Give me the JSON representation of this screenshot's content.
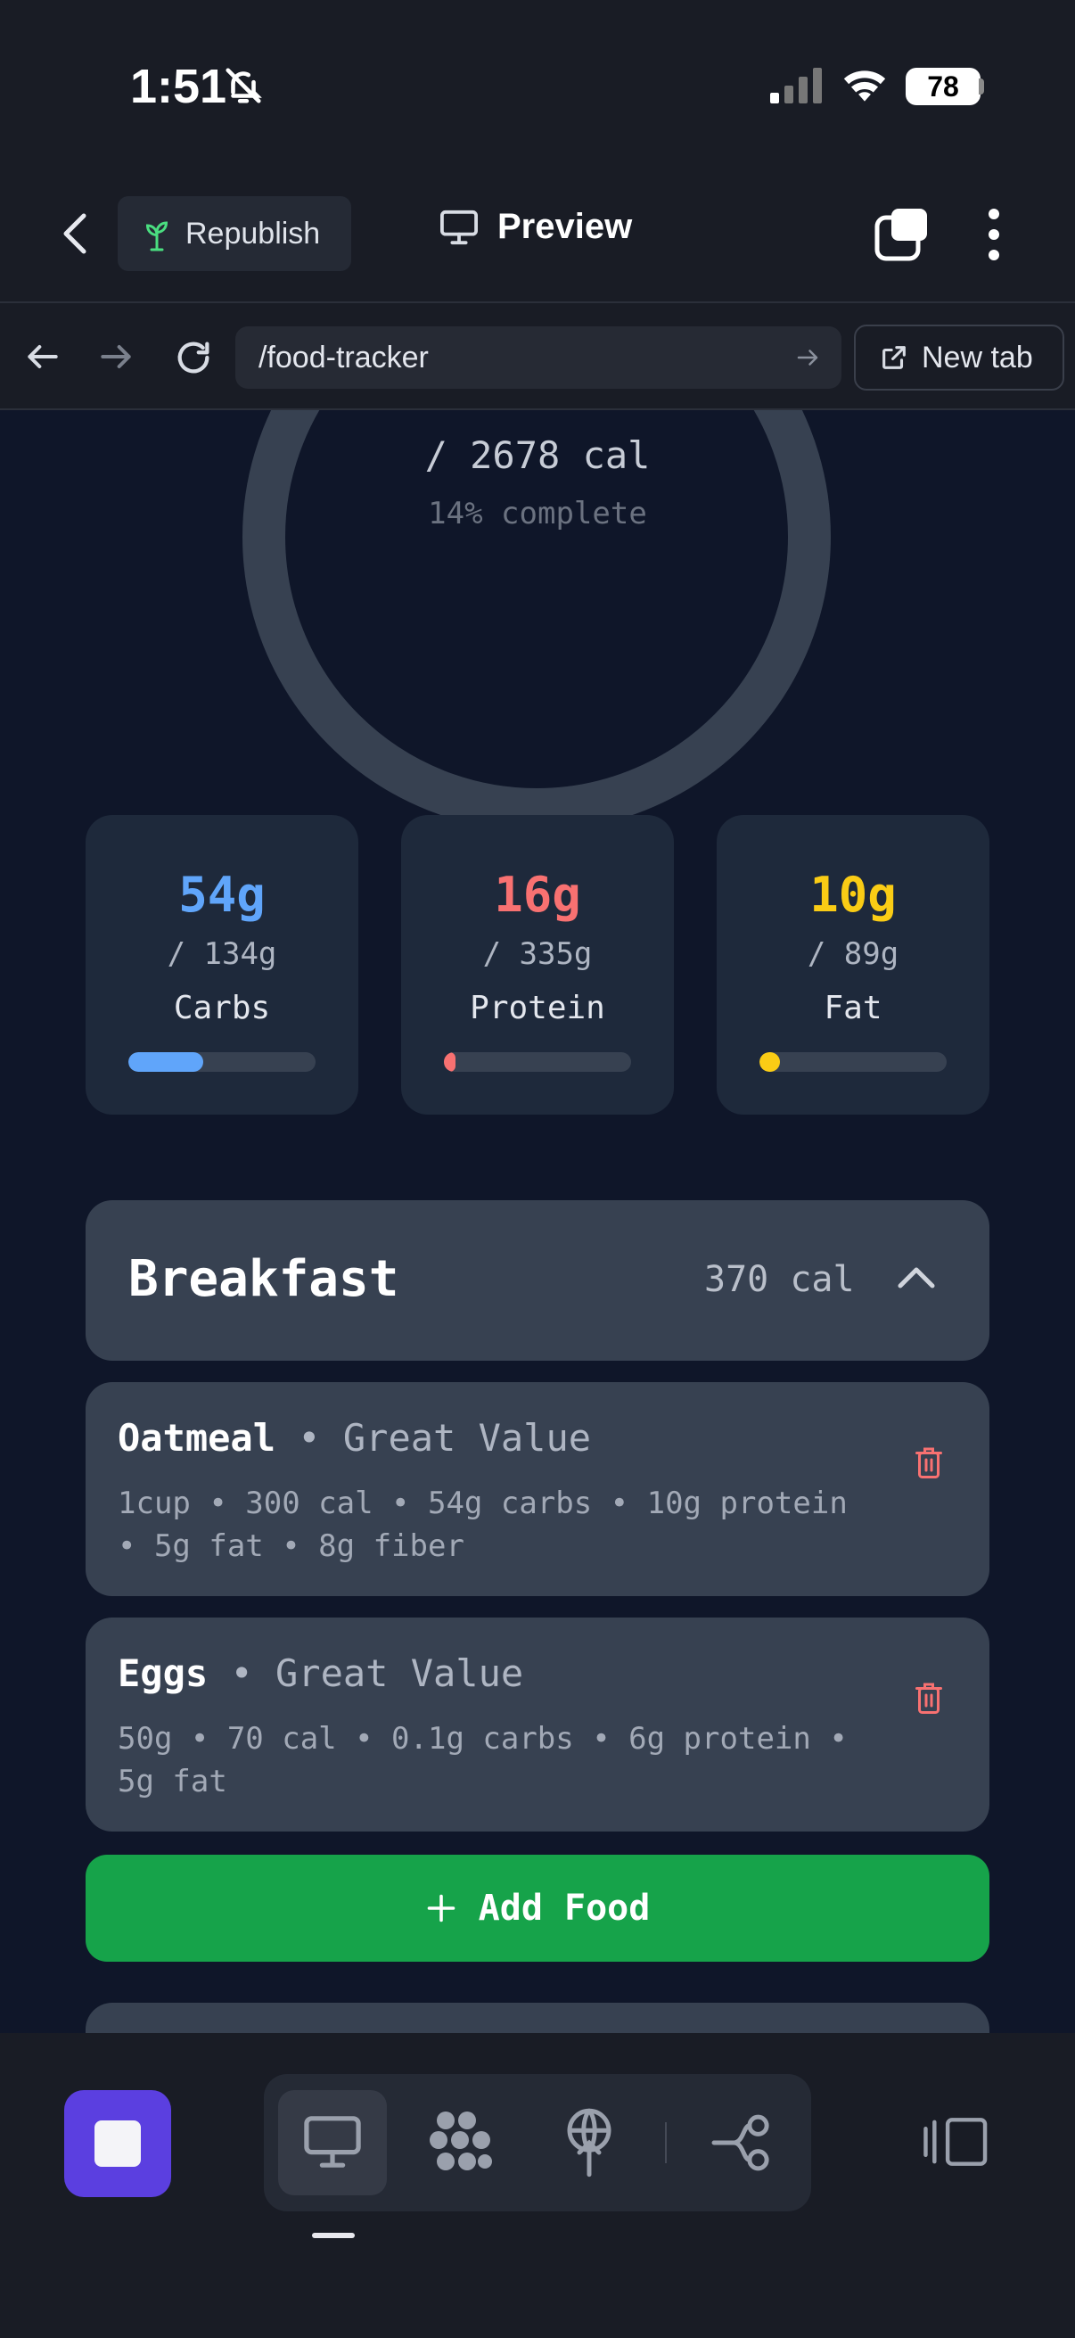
{
  "status": {
    "time": "1:51",
    "battery": "78"
  },
  "header": {
    "republish_label": "Republish",
    "preview_label": "Preview"
  },
  "browser": {
    "url": "/food-tracker",
    "new_tab_label": "New tab"
  },
  "calories": {
    "goal_text": "/ 2678 cal",
    "percent_text": "14% complete",
    "percent": 14
  },
  "macros": [
    {
      "value": "54g",
      "goal": "/ 134g",
      "name": "Carbs",
      "color": "#60a5fa",
      "progress": 0.4
    },
    {
      "value": "16g",
      "goal": "/ 335g",
      "name": "Protein",
      "color": "#f87171",
      "progress": 0.05
    },
    {
      "value": "10g",
      "goal": "/ 89g",
      "name": "Fat",
      "color": "#facc15",
      "progress": 0.11
    }
  ],
  "meal": {
    "title": "Breakfast",
    "calories": "370 cal",
    "foods": [
      {
        "name": "Oatmeal",
        "brand": " • Great Value",
        "details": "1cup • 300 cal • 54g carbs • 10g protein • 5g fat • 8g fiber"
      },
      {
        "name": "Eggs",
        "brand": " • Great Value",
        "details": "50g • 70 cal • 0.1g carbs • 6g protein • 5g fat"
      }
    ]
  },
  "add_food_label": "Add Food",
  "icons": [
    "bell-off-icon",
    "signal-icon",
    "wifi-icon",
    "back-icon",
    "sprout-icon",
    "monitor-icon",
    "tabs-icon",
    "more-vertical-icon",
    "arrow-left-icon",
    "arrow-right-icon",
    "refresh-icon",
    "go-arrow-icon",
    "external-link-icon",
    "chevron-up-icon",
    "trash-icon",
    "plus-icon",
    "stop-icon",
    "dots-icon",
    "antenna-icon",
    "share-nodes-icon",
    "side-panel-icon"
  ]
}
